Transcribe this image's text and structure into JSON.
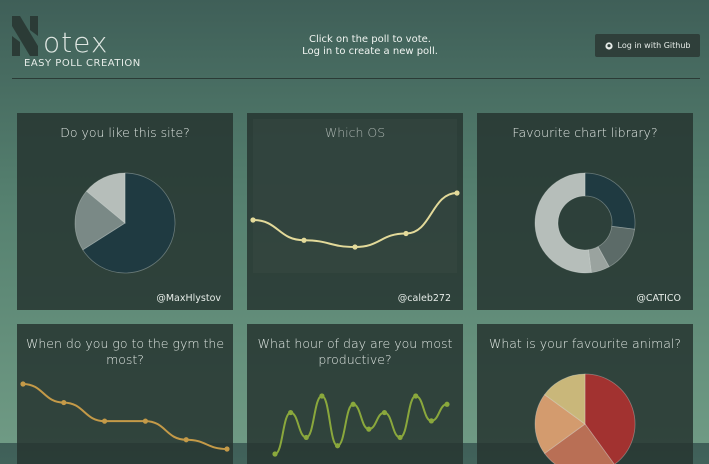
{
  "header": {
    "logo_word": "otex",
    "logo_tagline": "EASY POLL CREATION",
    "message_line1": "Click on the poll to vote.",
    "message_line2": "Log in to create a new poll.",
    "login_label": "Log in with Github"
  },
  "polls": [
    {
      "title": "Do you like this site?",
      "user": "@MaxHlystov"
    },
    {
      "title": "Which OS",
      "user": "@caleb272"
    },
    {
      "title": "Favourite chart library?",
      "user": "@CATICO"
    },
    {
      "title": "When do you go to the gym the most?",
      "user": ""
    },
    {
      "title": "What hour of day are you most productive?",
      "user": ""
    },
    {
      "title": "What is your favourite animal?",
      "user": ""
    }
  ],
  "chart_data": [
    {
      "type": "pie",
      "slices": [
        {
          "value": 66,
          "color": "#1f3a41"
        },
        {
          "value": 20,
          "color": "#7a8986"
        },
        {
          "value": 14,
          "color": "#b6beba"
        }
      ]
    },
    {
      "type": "line",
      "values": [
        5,
        2,
        1,
        3,
        9
      ],
      "color": "#e3da9a"
    },
    {
      "type": "pie",
      "donut": true,
      "slices": [
        {
          "value": 27,
          "color": "#1f3a41"
        },
        {
          "value": 15,
          "color": "#5c6b68"
        },
        {
          "value": 6,
          "color": "#9aa39f"
        },
        {
          "value": 52,
          "color": "#b6beba"
        }
      ]
    },
    {
      "type": "line",
      "values": [
        7,
        5,
        3,
        3,
        1,
        0
      ],
      "color": "#c49a48"
    },
    {
      "type": "line",
      "values": [
        1,
        6,
        3,
        8,
        2,
        7,
        4,
        6,
        3,
        8,
        5,
        7
      ],
      "color": "#8aa83c"
    },
    {
      "type": "pie",
      "slices": [
        {
          "value": 40,
          "color": "#a23230"
        },
        {
          "value": 25,
          "color": "#b96f55"
        },
        {
          "value": 20,
          "color": "#d39b6e"
        },
        {
          "value": 15,
          "color": "#c9b77a"
        }
      ]
    }
  ]
}
